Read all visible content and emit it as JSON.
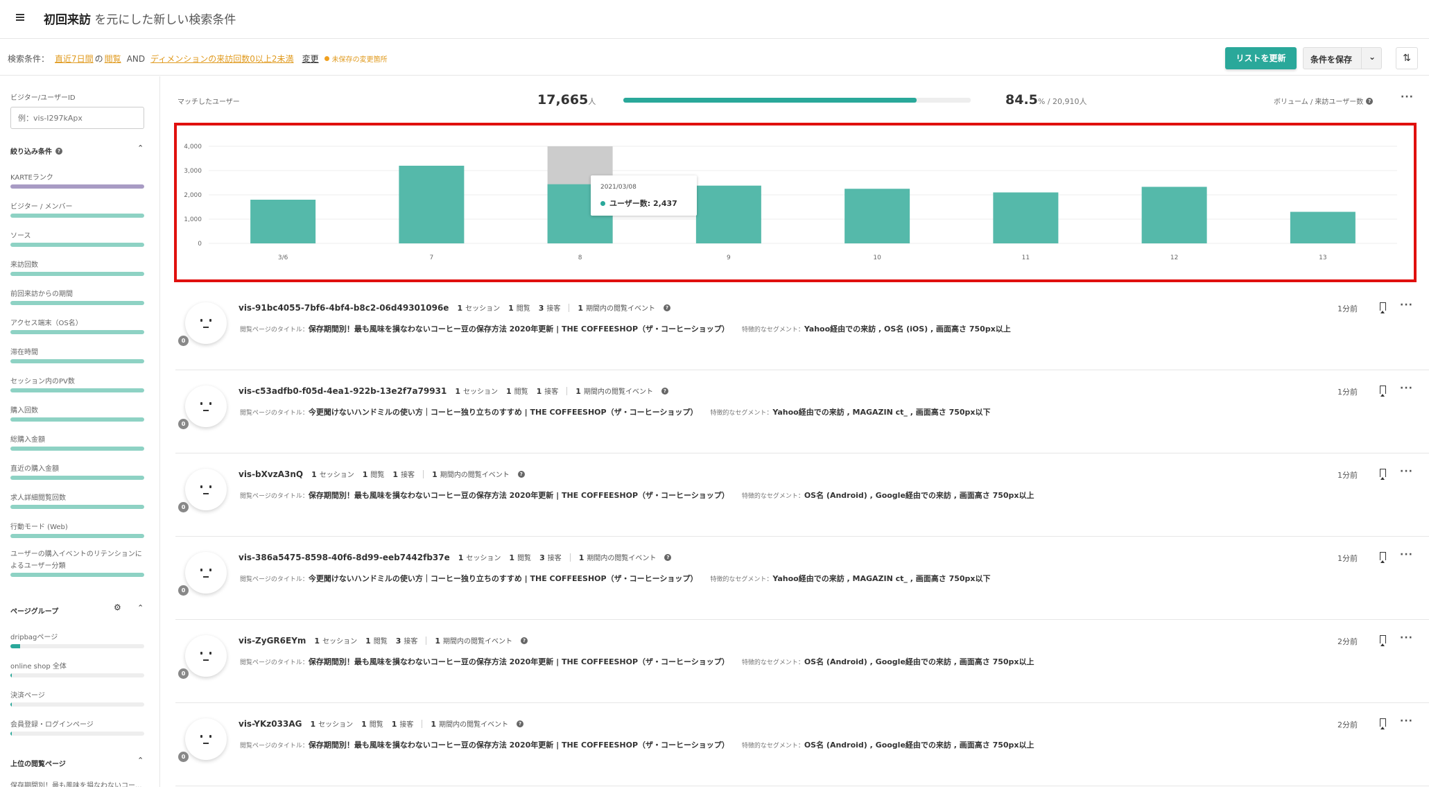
{
  "header": {
    "title_bold": "初回来訪",
    "title_rest": " を元にした新しい検索条件"
  },
  "condition": {
    "prefix": "検索条件：",
    "period": "直近7日間",
    "of": "の",
    "event": "閲覧",
    "and": "AND",
    "dimension": "ディメンションの来訪回数0以上2未満",
    "change": "変更",
    "unsaved": "未保存の変更箇所"
  },
  "toolbar": {
    "update_label": "リストを更新",
    "save_label": "条件を保存"
  },
  "sidebar": {
    "id_label": "ビジター/ユーザーID",
    "id_placeholder": "例：vis-I297kApx",
    "filter_title": "絞り込み条件",
    "filters": [
      {
        "label": "KARTEランク",
        "fill": 1.0,
        "color": "#a89bc4"
      },
      {
        "label": "ビジター / メンバー",
        "fill": 1.0,
        "color": "#8ed2c4"
      },
      {
        "label": "ソース",
        "fill": 1.0,
        "color": "#8ed2c4"
      },
      {
        "label": "来訪回数",
        "fill": 1.0,
        "color": "#8ed2c4"
      },
      {
        "label": "前回来訪からの期間",
        "fill": 1.0,
        "color": "#8ed2c4"
      },
      {
        "label": "アクセス端末（OS名）",
        "fill": 1.0,
        "color": "#8ed2c4"
      },
      {
        "label": "滞在時間",
        "fill": 1.0,
        "color": "#8ed2c4"
      },
      {
        "label": "セッション内のPV数",
        "fill": 1.0,
        "color": "#8ed2c4"
      },
      {
        "label": "購入回数",
        "fill": 1.0,
        "color": "#8ed2c4"
      },
      {
        "label": "総購入金額",
        "fill": 1.0,
        "color": "#8ed2c4"
      },
      {
        "label": "直近の購入金額",
        "fill": 1.0,
        "color": "#8ed2c4"
      },
      {
        "label": "求人詳細閲覧回数",
        "fill": 1.0,
        "color": "#8ed2c4"
      },
      {
        "label": "行動モード (Web)",
        "fill": 1.0,
        "color": "#8ed2c4"
      }
    ],
    "retention_label_1": "ユーザーの購入イベントのリテンションに",
    "retention_label_2": "よるユーザー分類",
    "page_group_title": "ページグループ",
    "page_groups": [
      {
        "label": "dripbagページ",
        "fill": 0.07
      },
      {
        "label": "online shop 全体",
        "fill": 0.01
      },
      {
        "label": "決済ページ",
        "fill": 0.01
      },
      {
        "label": "会員登録・ログインページ",
        "fill": 0.01
      }
    ],
    "top_pages_title": "上位の閲覧ページ",
    "top_page_1": "保存期間別！最も風味を損なわないコー..."
  },
  "summary": {
    "label": "マッチしたユーザー",
    "count": "17,665",
    "count_unit": "人",
    "progress": 0.845,
    "pct": "84.5",
    "pct_rest": "% / 20,910人",
    "volume_label": "ボリューム / 来訪ユーザー数"
  },
  "chart_data": {
    "type": "bar",
    "categories": [
      "3/6",
      "7",
      "8",
      "9",
      "10",
      "11",
      "12",
      "13"
    ],
    "values": [
      1800,
      3200,
      2437,
      2380,
      2250,
      2100,
      2330,
      1300
    ],
    "ylim": [
      0,
      4000
    ],
    "yticks": [
      "4,000",
      "3,000",
      "2,000",
      "1,000",
      "0"
    ],
    "highlight_index": 2,
    "color": "#55b9aa",
    "hover_color": "#cccccc",
    "tooltip": {
      "date": "2021/03/08",
      "label": "ユーザー数: 2,437"
    }
  },
  "meta_labels": {
    "session": "セッション",
    "view": "閲覧",
    "contact": "接客",
    "events": "期間内の閲覧イベント",
    "page_title": "閲覧ページのタイトル：",
    "segment": "特徴的なセグメント："
  },
  "visitors": [
    {
      "id": "vis-91bc4055-7bf6-4bf4-b8c2-06d49301096e",
      "sessions": "1",
      "views": "1",
      "contacts": "3",
      "events": "1",
      "page": "保存期間別！最も風味を損なわないコーヒー豆の保存方法 2020年更新 | THE COFFEESHOP（ザ・コーヒーショップ）",
      "segment": "Yahoo経由での来訪 , OS名 (iOS) , 画面高さ 750px以上",
      "time": "1分前",
      "badge": "0"
    },
    {
      "id": "vis-c53adfb0-f05d-4ea1-922b-13e2f7a79931",
      "sessions": "1",
      "views": "1",
      "contacts": "1",
      "events": "1",
      "page": "今更聞けないハンドミルの使い方｜コーヒー独り立ちのすすめ | THE COFFEESHOP（ザ・コーヒーショップ）",
      "segment": "Yahoo経由での来訪 , MAGAZIN ct_ , 画面高さ 750px以下",
      "time": "1分前",
      "badge": "0"
    },
    {
      "id": "vis-bXvzA3nQ",
      "sessions": "1",
      "views": "1",
      "contacts": "1",
      "events": "1",
      "page": "保存期間別！最も風味を損なわないコーヒー豆の保存方法 2020年更新 | THE COFFEESHOP（ザ・コーヒーショップ）",
      "segment": "OS名 (Android) , Google経由での来訪 , 画面高さ 750px以上",
      "time": "1分前",
      "badge": "0"
    },
    {
      "id": "vis-386a5475-8598-40f6-8d99-eeb7442fb37e",
      "sessions": "1",
      "views": "1",
      "contacts": "3",
      "events": "1",
      "page": "今更聞けないハンドミルの使い方｜コーヒー独り立ちのすすめ | THE COFFEESHOP（ザ・コーヒーショップ）",
      "segment": "Yahoo経由での来訪 , MAGAZIN ct_ , 画面高さ 750px以下",
      "time": "1分前",
      "badge": "0"
    },
    {
      "id": "vis-ZyGR6EYm",
      "sessions": "1",
      "views": "1",
      "contacts": "3",
      "events": "1",
      "page": "保存期間別！最も風味を損なわないコーヒー豆の保存方法 2020年更新 | THE COFFEESHOP（ザ・コーヒーショップ）",
      "segment": "OS名 (Android) , Google経由での来訪 , 画面高さ 750px以上",
      "time": "2分前",
      "badge": "0"
    },
    {
      "id": "vis-YKz033AG",
      "sessions": "1",
      "views": "1",
      "contacts": "1",
      "events": "1",
      "page": "保存期間別！最も風味を損なわないコーヒー豆の保存方法 2020年更新 | THE COFFEESHOP（ザ・コーヒーショップ）",
      "segment": "OS名 (Android) , Google経由での来訪 , 画面高さ 750px以上",
      "time": "2分前",
      "badge": "0"
    }
  ]
}
